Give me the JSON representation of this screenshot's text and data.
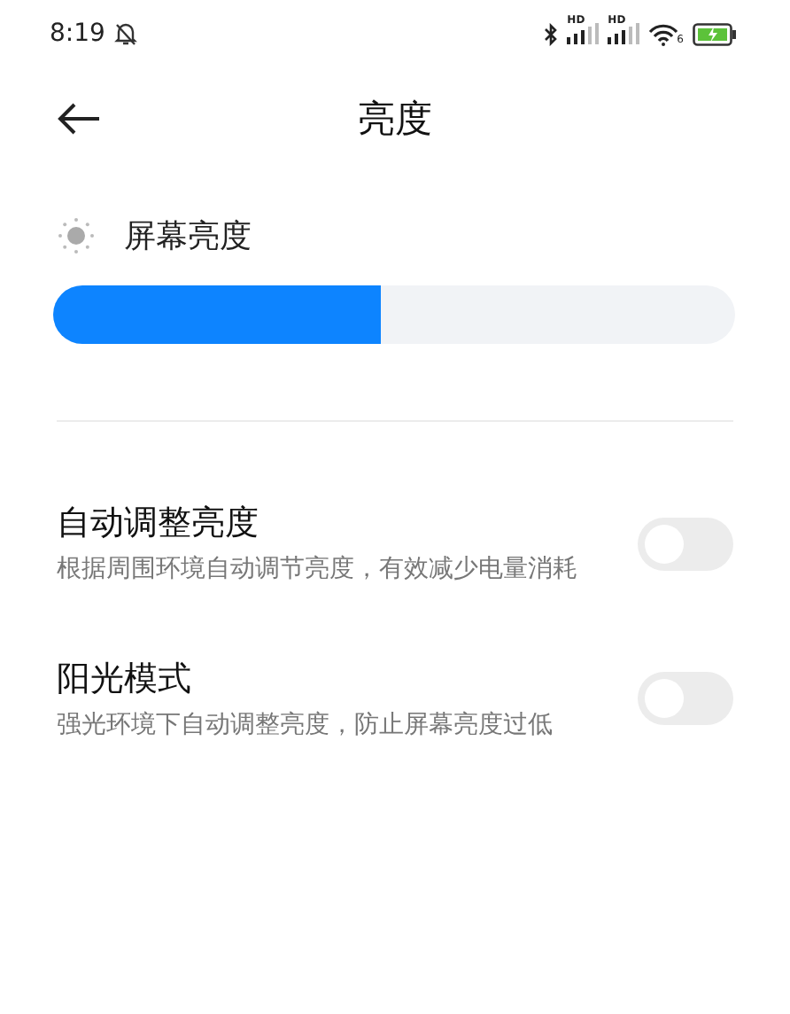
{
  "status_bar": {
    "time": "8:19",
    "signals": [
      {
        "label": "HD"
      },
      {
        "label": "HD"
      }
    ],
    "wifi_label": "6"
  },
  "header": {
    "title": "亮度"
  },
  "brightness": {
    "label": "屏幕亮度",
    "level": 0.48
  },
  "settings": [
    {
      "title": "自动调整亮度",
      "description": "根据周围环境自动调节亮度，有效减少电量消耗",
      "on": false
    },
    {
      "title": "阳光模式",
      "description": "强光环境下自动调整亮度，防止屏幕亮度过低",
      "on": false
    }
  ]
}
